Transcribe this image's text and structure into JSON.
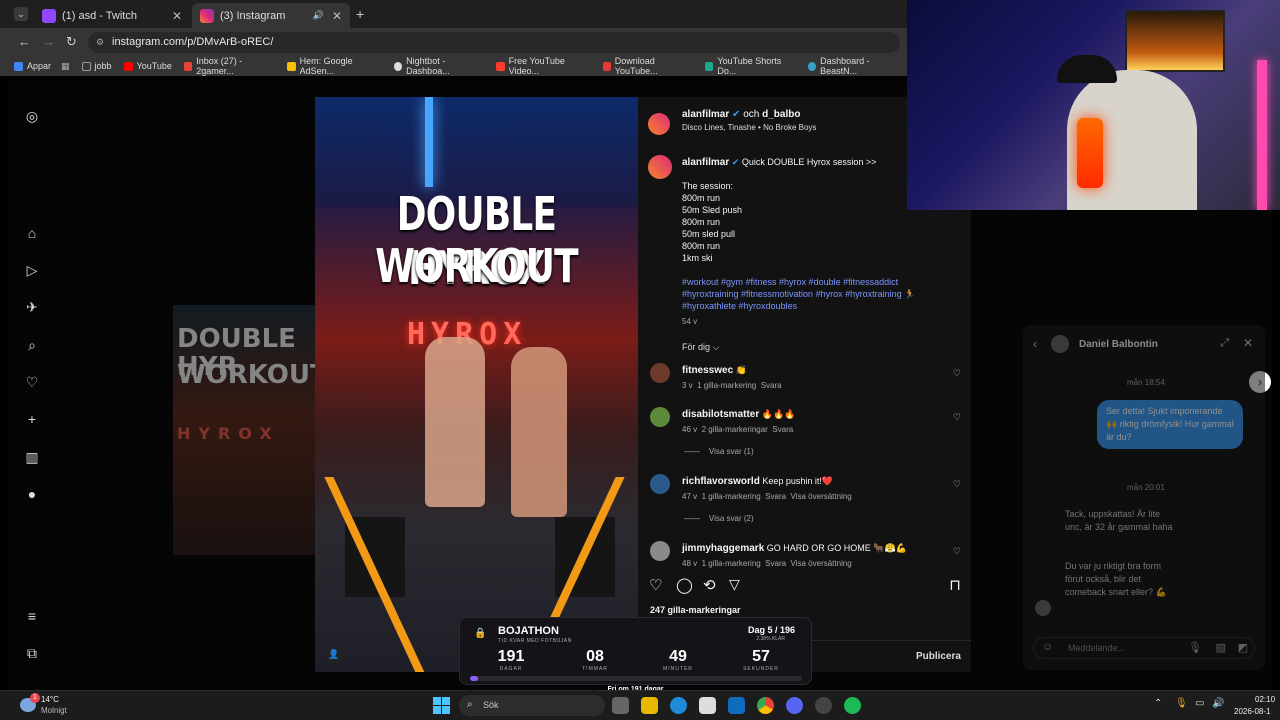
{
  "browser": {
    "tabs": [
      {
        "title": "(1) asd - Twitch",
        "color": "#9146ff"
      },
      {
        "title": "(3) Instagram",
        "color": "#e1306c"
      }
    ],
    "new_tab": "+",
    "url": "instagram.com/p/DMvArB-oREC/",
    "bookmarks": [
      {
        "label": "Appar",
        "color": "#4285f4"
      },
      {
        "label": "jobb",
        "color": "#888888"
      },
      {
        "label": "YouTube",
        "color": "#ff0000"
      },
      {
        "label": "Inbox (27) - 2gamer...",
        "color": "#ea4335"
      },
      {
        "label": "Hem: Google AdSen...",
        "color": "#fbbc04"
      },
      {
        "label": "Nightbot - Dashboa...",
        "color": "#dddddd"
      },
      {
        "label": "Free YouTube Video...",
        "color": "#ff3b30"
      },
      {
        "label": "Download YouTube...",
        "color": "#e53935"
      },
      {
        "label": "YouTube Shorts Do...",
        "color": "#1ea88b"
      },
      {
        "label": "Dashboard - BeastN...",
        "color": "#39a0c8"
      }
    ]
  },
  "post": {
    "headline1": "DOUBLE HYROX",
    "headline2": "WORKOUT",
    "neon": "HYROX",
    "bg_line1": "DOUBLE HYR",
    "bg_line2": "WORKOUT",
    "bg_neon": "HYROX",
    "author": "alanfilmar",
    "coauthor_sep": "och",
    "coauthor": "d_balbo",
    "audio": "Disco Lines, Tinashe • No Broke Boys",
    "caption_title": "Quick DOUBLE Hyrox session >>",
    "caption_lines": [
      "The session:",
      "800m run",
      "50m Sled push",
      "800m run",
      "50m sled pull",
      "800m run",
      "1km ski"
    ],
    "hashtags1": "#workout #gym #fitness #hyrox #double #fitnessaddict",
    "hashtags2": "#hyroxtraining #fitnessmotivation #hyrox #hyroxtraining 🏃",
    "hashtags3": "#hyroxathlete #hyroxdoubles",
    "caption_age": "54 v",
    "filter": "För dig ⌵",
    "comments": [
      {
        "user": "fitnesswec",
        "text": "👏",
        "age": "3 v",
        "likes": "1 gilla-markering",
        "reply": "Svara",
        "extra": "",
        "view": ""
      },
      {
        "user": "disabilotsmatter",
        "text": "🔥🔥🔥",
        "age": "46 v",
        "likes": "2 gilla-markeringar",
        "reply": "Svara",
        "extra": "",
        "view": "Visa svar (1)"
      },
      {
        "user": "richflavorsworld",
        "text": "Keep pushin it!❤️",
        "age": "47 v",
        "likes": "1 gilla-markering",
        "reply": "Svara",
        "extra": "Visa översättning",
        "view": "Visa svar (2)"
      },
      {
        "user": "jimmyhaggemark",
        "text": "GO HARD OR GO HOME 🐂😤💪",
        "age": "48 v",
        "likes": "1 gilla-markering",
        "reply": "Svara",
        "extra": "Visa översättning",
        "view": ""
      }
    ],
    "likes_total": "247 gilla-markeringar",
    "publish": "Publicera"
  },
  "dm": {
    "name": "Daniel Balbontin",
    "time1": "mån 18:54",
    "outgoing": "Ser detta! Sjukt imponerande 🙌 riktig drömfysik! Hur gammal är du?",
    "time2": "mån 20:01",
    "incoming1": "Tack, uppskattas! Är lite unc, är 32 år gammal haha",
    "incoming2": "Du var ju riktigt bra form förut också, blir det comeback snart eller? 💪",
    "input_placeholder": "Meddelande..."
  },
  "overlay": {
    "title": "BOJATHON",
    "subtitle": "TID KVAR MED FOTBOJAN",
    "day": "Dag 5 / 196",
    "pct": "2.38% KLAR",
    "days": "191",
    "days_label": "DAGAR",
    "hours": "08",
    "hours_label": "TIMMAR",
    "minutes": "49",
    "minutes_label": "MINUTER",
    "seconds": "57",
    "seconds_label": "SEKUNDER",
    "progress": 0.0238,
    "footer": "Fri om 191 dagar"
  },
  "taskbar": {
    "weather_temp": "14°C",
    "weather_desc": "Molnigt",
    "weather_badge": "1",
    "search": "Sök",
    "time": "02:10",
    "date": "2026-08-1"
  },
  "icons": {
    "colors": {
      "accent_link": "#7b95ff",
      "ig_bg": "#121212",
      "dm_bubble": "#3797f0",
      "progress": "#8b5cf6"
    }
  }
}
